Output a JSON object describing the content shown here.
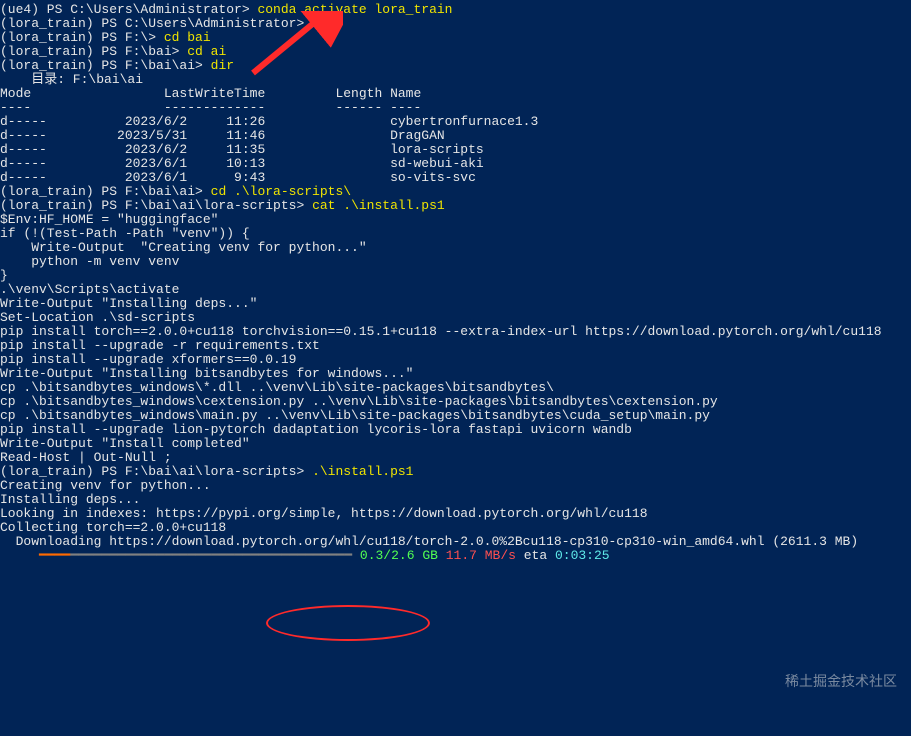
{
  "lines": [
    {
      "segments": [
        {
          "text": "(ue4) PS C:\\Users\\Administrator> ",
          "cls": "white"
        },
        {
          "text": "conda activate lora_train",
          "cls": "yellow"
        }
      ]
    },
    {
      "segments": [
        {
          "text": "(lora_train) PS C:\\Users\\Administrator> ",
          "cls": "white"
        },
        {
          "text": "f:",
          "cls": "yellow"
        }
      ]
    },
    {
      "segments": [
        {
          "text": "(lora_train) PS F:\\> ",
          "cls": "white"
        },
        {
          "text": "cd bai",
          "cls": "yellow"
        }
      ]
    },
    {
      "segments": [
        {
          "text": "(lora_train) PS F:\\bai> ",
          "cls": "white"
        },
        {
          "text": "cd ai",
          "cls": "yellow"
        }
      ]
    },
    {
      "segments": [
        {
          "text": "(lora_train) PS F:\\bai\\ai> ",
          "cls": "white"
        },
        {
          "text": "dir",
          "cls": "yellow"
        }
      ]
    },
    {
      "segments": [
        {
          "text": "",
          "cls": "white"
        }
      ]
    },
    {
      "segments": [
        {
          "text": "",
          "cls": "white"
        }
      ]
    },
    {
      "segments": [
        {
          "text": "    目录: F:\\bai\\ai",
          "cls": "white"
        }
      ]
    },
    {
      "segments": [
        {
          "text": "",
          "cls": "white"
        }
      ]
    },
    {
      "segments": [
        {
          "text": "",
          "cls": "white"
        }
      ]
    },
    {
      "segments": [
        {
          "text": "Mode                 LastWriteTime         Length Name",
          "cls": "white"
        }
      ]
    },
    {
      "segments": [
        {
          "text": "----                 -------------         ------ ----",
          "cls": "white"
        }
      ]
    },
    {
      "segments": [
        {
          "text": "d-----          2023/6/2     11:26                cybertronfurnace1.3",
          "cls": "white"
        }
      ]
    },
    {
      "segments": [
        {
          "text": "d-----         2023/5/31     11:46                DragGAN",
          "cls": "white"
        }
      ]
    },
    {
      "segments": [
        {
          "text": "d-----          2023/6/2     11:35                lora-scripts",
          "cls": "white"
        }
      ]
    },
    {
      "segments": [
        {
          "text": "d-----          2023/6/1     10:13                sd-webui-aki",
          "cls": "white"
        }
      ]
    },
    {
      "segments": [
        {
          "text": "d-----          2023/6/1      9:43                so-vits-svc",
          "cls": "white"
        }
      ]
    },
    {
      "segments": [
        {
          "text": "",
          "cls": "white"
        }
      ]
    },
    {
      "segments": [
        {
          "text": "",
          "cls": "white"
        }
      ]
    },
    {
      "segments": [
        {
          "text": "(lora_train) PS F:\\bai\\ai> ",
          "cls": "white"
        },
        {
          "text": "cd .\\lora-scripts\\",
          "cls": "yellow"
        }
      ]
    },
    {
      "segments": [
        {
          "text": "(lora_train) PS F:\\bai\\ai\\lora-scripts> ",
          "cls": "white"
        },
        {
          "text": "cat .\\install.ps1",
          "cls": "yellow"
        }
      ]
    },
    {
      "segments": [
        {
          "text": "$Env:HF_HOME = \"huggingface\"",
          "cls": "white"
        }
      ]
    },
    {
      "segments": [
        {
          "text": "",
          "cls": "white"
        }
      ]
    },
    {
      "segments": [
        {
          "text": "if (!(Test-Path -Path \"venv\")) {",
          "cls": "white"
        }
      ]
    },
    {
      "segments": [
        {
          "text": "    Write-Output  \"Creating venv for python...\"",
          "cls": "white"
        }
      ]
    },
    {
      "segments": [
        {
          "text": "    python -m venv venv",
          "cls": "white"
        }
      ]
    },
    {
      "segments": [
        {
          "text": "}",
          "cls": "white"
        }
      ]
    },
    {
      "segments": [
        {
          "text": ".\\venv\\Scripts\\activate",
          "cls": "white"
        }
      ]
    },
    {
      "segments": [
        {
          "text": "",
          "cls": "white"
        }
      ]
    },
    {
      "segments": [
        {
          "text": "Write-Output \"Installing deps...\"",
          "cls": "white"
        }
      ]
    },
    {
      "segments": [
        {
          "text": "Set-Location .\\sd-scripts",
          "cls": "white"
        }
      ]
    },
    {
      "segments": [
        {
          "text": "pip install torch==2.0.0+cu118 torchvision==0.15.1+cu118 --extra-index-url https://download.pytorch.org/whl/cu118",
          "cls": "white"
        }
      ]
    },
    {
      "segments": [
        {
          "text": "pip install --upgrade -r requirements.txt",
          "cls": "white"
        }
      ]
    },
    {
      "segments": [
        {
          "text": "pip install --upgrade xformers==0.0.19",
          "cls": "white"
        }
      ]
    },
    {
      "segments": [
        {
          "text": "",
          "cls": "white"
        }
      ]
    },
    {
      "segments": [
        {
          "text": "Write-Output \"Installing bitsandbytes for windows...\"",
          "cls": "white"
        }
      ]
    },
    {
      "segments": [
        {
          "text": "cp .\\bitsandbytes_windows\\*.dll ..\\venv\\Lib\\site-packages\\bitsandbytes\\",
          "cls": "white"
        }
      ]
    },
    {
      "segments": [
        {
          "text": "cp .\\bitsandbytes_windows\\cextension.py ..\\venv\\Lib\\site-packages\\bitsandbytes\\cextension.py",
          "cls": "white"
        }
      ]
    },
    {
      "segments": [
        {
          "text": "cp .\\bitsandbytes_windows\\main.py ..\\venv\\Lib\\site-packages\\bitsandbytes\\cuda_setup\\main.py",
          "cls": "white"
        }
      ]
    },
    {
      "segments": [
        {
          "text": "",
          "cls": "white"
        }
      ]
    },
    {
      "segments": [
        {
          "text": "pip install --upgrade lion-pytorch dadaptation lycoris-lora fastapi uvicorn wandb",
          "cls": "white"
        }
      ]
    },
    {
      "segments": [
        {
          "text": "",
          "cls": "white"
        }
      ]
    },
    {
      "segments": [
        {
          "text": "Write-Output \"Install completed\"",
          "cls": "white"
        }
      ]
    },
    {
      "segments": [
        {
          "text": "Read-Host | Out-Null ;",
          "cls": "white"
        }
      ]
    },
    {
      "segments": [
        {
          "text": "(lora_train) PS F:\\bai\\ai\\lora-scripts> ",
          "cls": "white"
        },
        {
          "text": ".\\install.ps1",
          "cls": "yellow"
        }
      ]
    },
    {
      "segments": [
        {
          "text": "Creating venv for python...",
          "cls": "white"
        }
      ]
    },
    {
      "segments": [
        {
          "text": "Installing deps...",
          "cls": "white"
        }
      ]
    },
    {
      "segments": [
        {
          "text": "Looking in indexes: https://pypi.org/simple, https://download.pytorch.org/whl/cu118",
          "cls": "white"
        }
      ]
    },
    {
      "segments": [
        {
          "text": "Collecting torch==2.0.0+cu118",
          "cls": "white"
        }
      ]
    },
    {
      "segments": [
        {
          "text": "  Downloading https://download.pytorch.org/whl/cu118/torch-2.0.0%2Bcu118-cp310-cp310-win_amd64.whl (2611.3 MB)",
          "cls": "white"
        }
      ]
    },
    {
      "segments": [
        {
          "text": "     ",
          "cls": "white"
        },
        {
          "text": "━━━━",
          "cls": "orange"
        },
        {
          "text": "━━━━━━━━━━━━━━━━━━━━━━━━━━━━━━━━━━━━",
          "cls": "gray"
        },
        {
          "text": " ",
          "cls": "white"
        },
        {
          "text": "0.3/2.6 GB",
          "cls": "green"
        },
        {
          "text": " ",
          "cls": "white"
        },
        {
          "text": "11.7 MB/s",
          "cls": "red"
        },
        {
          "text": " eta ",
          "cls": "white"
        },
        {
          "text": "0:03:25",
          "cls": "cyan"
        }
      ]
    }
  ],
  "watermark": "稀土掘金技术社区",
  "annotations": {
    "arrow_color": "#ff2a2a",
    "circle_color": "#ff2a2a"
  }
}
